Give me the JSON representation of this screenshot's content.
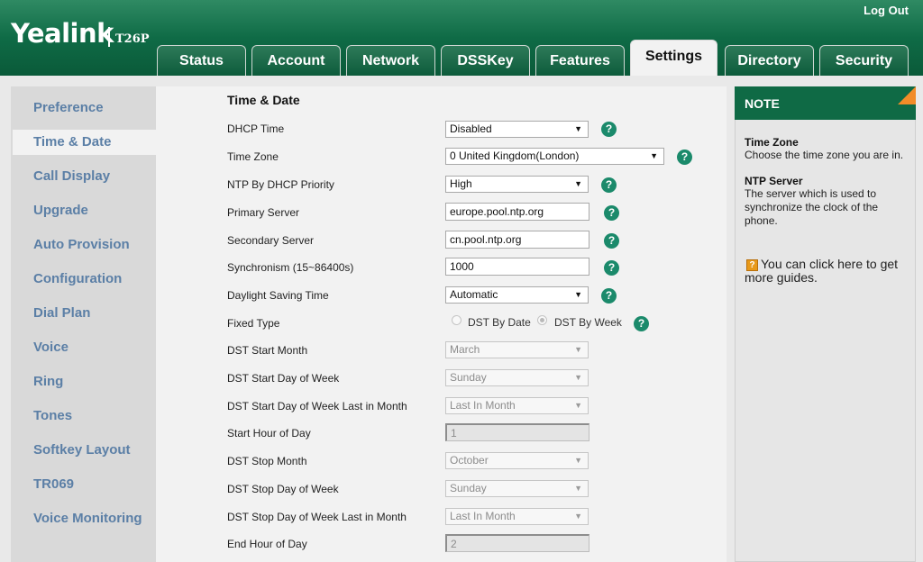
{
  "header": {
    "logo": "Yealink",
    "model": "T26P",
    "logout": "Log Out",
    "tabs": [
      {
        "label": "Status"
      },
      {
        "label": "Account"
      },
      {
        "label": "Network"
      },
      {
        "label": "DSSKey"
      },
      {
        "label": "Features"
      },
      {
        "label": "Settings",
        "active": true
      },
      {
        "label": "Directory"
      },
      {
        "label": "Security"
      }
    ]
  },
  "sidebar": {
    "items": [
      {
        "label": "Preference"
      },
      {
        "label": "Time & Date",
        "active": true
      },
      {
        "label": "Call Display"
      },
      {
        "label": "Upgrade"
      },
      {
        "label": "Auto Provision"
      },
      {
        "label": "Configuration"
      },
      {
        "label": "Dial Plan"
      },
      {
        "label": "Voice"
      },
      {
        "label": "Ring"
      },
      {
        "label": "Tones"
      },
      {
        "label": "Softkey Layout"
      },
      {
        "label": "TR069"
      },
      {
        "label": "Voice Monitoring"
      }
    ]
  },
  "form": {
    "title": "Time & Date",
    "dhcp_time": {
      "label": "DHCP Time",
      "value": "Disabled"
    },
    "time_zone": {
      "label": "Time Zone",
      "value": "0 United Kingdom(London)"
    },
    "ntp_priority": {
      "label": "NTP By DHCP Priority",
      "value": "High"
    },
    "primary_server": {
      "label": "Primary Server",
      "value": "europe.pool.ntp.org"
    },
    "secondary_server": {
      "label": "Secondary Server",
      "value": "cn.pool.ntp.org"
    },
    "synchronism": {
      "label": "Synchronism (15~86400s)",
      "value": "1000"
    },
    "dst": {
      "label": "Daylight Saving Time",
      "value": "Automatic"
    },
    "fixed_type": {
      "label": "Fixed Type",
      "opt1": "DST By Date",
      "opt2": "DST By Week",
      "selected": "DST By Week"
    },
    "start_month": {
      "label": "DST Start Month",
      "value": "March"
    },
    "start_dow": {
      "label": "DST Start Day of Week",
      "value": "Sunday"
    },
    "start_last": {
      "label": "DST Start Day of Week Last in Month",
      "value": "Last In Month"
    },
    "start_hour": {
      "label": "Start Hour of Day",
      "value": "1"
    },
    "stop_month": {
      "label": "DST Stop Month",
      "value": "October"
    },
    "stop_dow": {
      "label": "DST Stop Day of Week",
      "value": "Sunday"
    },
    "stop_last": {
      "label": "DST Stop Day of Week Last in Month",
      "value": "Last In Month"
    },
    "end_hour": {
      "label": "End Hour of Day",
      "value": "2"
    },
    "help_glyph": "?"
  },
  "note": {
    "title": "NOTE",
    "tz_heading": "Time Zone",
    "tz_text": "Choose the time zone you are in.",
    "ntp_heading": "NTP Server",
    "ntp_text": "The server which is used to synchronize the clock of the phone.",
    "guide_text": "You can click here to get more guides.",
    "guide_icon_glyph": "?"
  },
  "colors": {
    "header_green": "#0f6b46",
    "help_green": "#1b8a6b",
    "sidebar_link": "#5b7fa6",
    "note_corner": "#f28c28"
  }
}
